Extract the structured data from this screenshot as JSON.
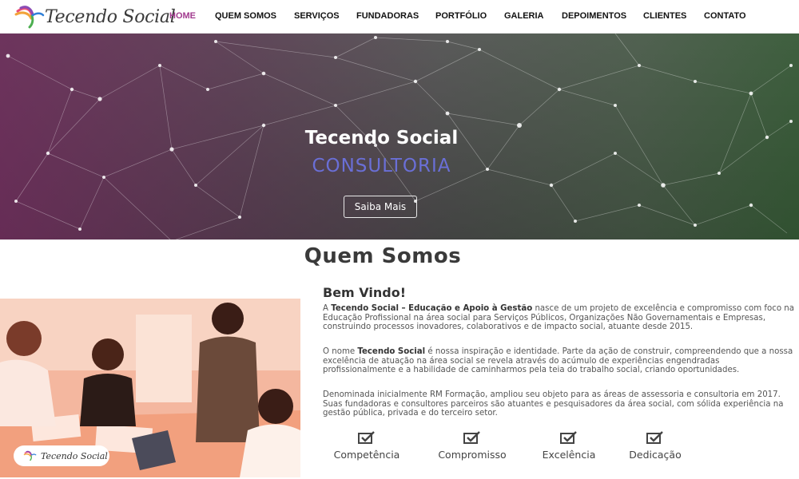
{
  "brand": {
    "name": "Tecendo Social"
  },
  "nav": {
    "items": [
      {
        "label": "HOME",
        "active": true
      },
      {
        "label": "QUEM SOMOS"
      },
      {
        "label": "SERVIÇOS"
      },
      {
        "label": "FUNDADORAS"
      },
      {
        "label": "PORTFÓLIO"
      },
      {
        "label": "GALERIA"
      },
      {
        "label": "DEPOIMENTOS"
      },
      {
        "label": "CLIENTES"
      },
      {
        "label": "CONTATO"
      }
    ],
    "active_color": "#a23b8f"
  },
  "hero": {
    "title": "Tecendo Social",
    "subtitle": "CONSULTORIA",
    "button": "Saiba Mais",
    "subtitle_color": "#6a6fd6"
  },
  "about": {
    "title": "Quem Somos",
    "welcome": "Bem Vindo!",
    "p1_pre": "A ",
    "p1_bold": "Tecendo Social – Educação e Apoio à Gestão",
    "p1_post": " nasce de um projeto de excelência e compromisso com foco na Educação Profissional na área social para Serviços Públicos, Organizações Não Governamentais e Empresas, construindo processos inovadores, colaborativos e de impacto social, atuante desde 2015.",
    "p2_pre": "O nome ",
    "p2_bold": "Tecendo Social",
    "p2_post": " é nossa inspiração e identidade. Parte da ação de construir, compreendendo que a nossa excelência de atuação na área social se revela através do acúmulo de experiências engendradas profissionalmente e a habilidade de caminharmos pela teia do trabalho social, criando oportunidades.",
    "p3": "Denominada inicialmente RM Formação, ampliou seu objeto para as áreas de assessoria e consultoria em 2017. Suas fundadoras e consultores parceiros são atuantes e pesquisadores da área social, com sólida experiência na gestão pública, privada e do terceiro setor.",
    "photo_logo": "Tecendo Social",
    "values": [
      {
        "label": "Competência",
        "icon": "check-square-icon"
      },
      {
        "label": "Compromisso",
        "icon": "check-square-icon"
      },
      {
        "label": "Excelência",
        "icon": "check-square-icon"
      },
      {
        "label": "Dedicação",
        "icon": "check-square-icon"
      }
    ]
  }
}
